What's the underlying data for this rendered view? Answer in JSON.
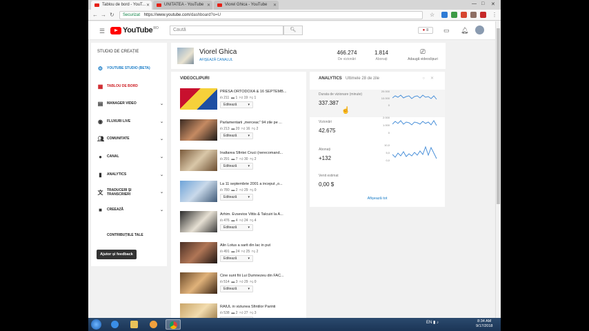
{
  "browser": {
    "tabs": [
      {
        "title": "Tablou de bord - YouT..."
      },
      {
        "title": "UNITATEA - YouTube"
      },
      {
        "title": "Viorel Ghica - YouTube"
      }
    ],
    "security_label": "Securizat",
    "url_host": "https://www.youtube.com",
    "url_path": "/dashboard?o=U"
  },
  "header": {
    "logo_word": "YouTube",
    "logo_region": "RO",
    "search_placeholder": "Caută"
  },
  "sidebar": {
    "title": "STUDIO DE CREAȚIE",
    "items": [
      {
        "label": "YOUTUBE STUDIO (BETA)",
        "icon": "gear-icon"
      },
      {
        "label": "TABLOU DE BORD",
        "icon": "dashboard-icon"
      },
      {
        "label": "MANAGER VIDEO",
        "icon": "video-manager-icon"
      },
      {
        "label": "FLUXURI LIVE",
        "icon": "live-icon"
      },
      {
        "label": "COMUNITATE",
        "icon": "community-icon"
      },
      {
        "label": "CANAL",
        "icon": "channel-icon"
      },
      {
        "label": "ANALYTICS",
        "icon": "analytics-icon"
      },
      {
        "label": "TRADUCERI ȘI TRANSCRIERI",
        "icon": "translate-icon"
      },
      {
        "label": "CREEAZĂ",
        "icon": "create-icon"
      },
      {
        "label": "CONTRIBUȚIILE TALE",
        "icon": "contributions-icon"
      }
    ],
    "feedback_label": "Ajutor și feedback"
  },
  "channel": {
    "name": "Viorel Ghica",
    "view_channel": "AFIȘEAZĂ CANALUL",
    "views_value": "466.274",
    "views_label": "De vizionări",
    "subs_value": "1.814",
    "subs_label": "Abonați",
    "upload_label": "Adaugă videoclipuri"
  },
  "videos": {
    "title": "VIDEOCLIPURI",
    "edit_label": "Editează",
    "items": [
      {
        "title": "PRESA ORTODOXĂ & 16 SEPTEMB...",
        "views": "211",
        "comments": "1",
        "likes": "19",
        "dislikes": "1"
      },
      {
        "title": "Parlamentarii „merceac” 94 zile pe ...",
        "views": "213",
        "comments": "20",
        "likes": "16",
        "dislikes": "2"
      },
      {
        "title": "Inaltarea Sfintei Cruci (nerecomand...",
        "views": "291",
        "comments": "7",
        "likes": "30",
        "dislikes": "2"
      },
      {
        "title": "La 11 septembrie 2001 a inceput „o...",
        "views": "780",
        "comments": "2",
        "likes": "29",
        "dislikes": "0"
      },
      {
        "title": "Arhim. Evsevios Vittis & Talcuiri la A...",
        "views": "476",
        "comments": "4",
        "likes": "24",
        "dislikes": "4"
      },
      {
        "title": "Alin Lotus a sarit din lac in put",
        "views": "491",
        "comments": "24",
        "likes": "25",
        "dislikes": "2"
      },
      {
        "title": "Cine sunt fiii Lui Dumnezeu din FAC...",
        "views": "514",
        "comments": "3",
        "likes": "29",
        "dislikes": "0"
      },
      {
        "title": "RAIUL in viziunea Sfintilor Parinti",
        "views": "538",
        "comments": "2",
        "likes": "27",
        "dislikes": "3"
      }
    ]
  },
  "analytics": {
    "title": "ANALYTICS",
    "subtitle": "Ultimele 28 de zile",
    "show_all": "Afișează tot",
    "metrics": [
      {
        "label": "Durata de vizionare (minute)",
        "value": "337.387",
        "ticks": [
          "20.000",
          "10.000",
          "0"
        ]
      },
      {
        "label": "Vizionări",
        "value": "42.675",
        "ticks": [
          "2.000",
          "1.000",
          "0"
        ]
      },
      {
        "label": "Abonați",
        "value": "+132",
        "ticks": [
          "10,0",
          "5,0",
          "0,0"
        ]
      },
      {
        "label": "Venit estimat",
        "value": "0,00 $",
        "ticks": []
      }
    ]
  },
  "taskbar": {
    "time": "8:34 AM",
    "date": "9/17/2018",
    "tray_lang": "EN"
  }
}
